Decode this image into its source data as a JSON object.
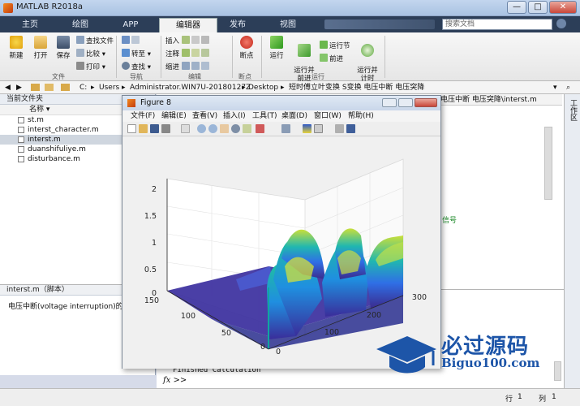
{
  "window": {
    "title": "MATLAB R2018a",
    "min": "—",
    "max": "□",
    "close": "✕"
  },
  "tabs": [
    "主页",
    "绘图",
    "APP",
    "编辑器",
    "发布",
    "视图"
  ],
  "search": {
    "placeholder": "搜索文档"
  },
  "ribbon": {
    "file": {
      "new": "新建",
      "open": "打开",
      "save": "保存",
      "find_files": "查找文件",
      "compare": "比较",
      "print": "打印",
      "group": "文件"
    },
    "nav": {
      "goto": "转至",
      "find": "查找",
      "group": "导航"
    },
    "edit": {
      "insert": "插入",
      "comment": "注释",
      "indent": "缩进",
      "group": "编辑"
    },
    "breakpoints": {
      "bp": "断点",
      "group": "断点"
    },
    "run": {
      "run": "运行",
      "run_advance": "运行并\n前进",
      "run_section": "运行节",
      "advance": "前进",
      "run_time": "运行并\n计时",
      "group": "运行"
    }
  },
  "path": {
    "segments": [
      "C:",
      "Users",
      "Administrator.WIN7U-20180127Z",
      "Desktop",
      "短时傅立叶变换 S变换 电压中断 电压突降"
    ]
  },
  "left_panel": {
    "title": "当前文件夹",
    "column": "名称",
    "files": [
      "st.m",
      "interst_character.m",
      "interst.m",
      "duanshifuliye.m",
      "disturbance.m"
    ],
    "selected_index": 2,
    "detail_title": "interst.m（脚本）",
    "detail_text": "电压中断(voltage interruption)的ST"
  },
  "editor": {
    "tab_path": "电压中断 电压突降\\interst.m",
    "comment_fragment": "信号"
  },
  "right_bar": {
    "label": "工作区"
  },
  "command": {
    "output": "Finished Calculation",
    "prompt": "fx >>"
  },
  "status": {
    "row_label": "行",
    "row": "1",
    "col_label": "列",
    "col": "1"
  },
  "figure": {
    "title": "Figure 8",
    "menu": [
      "文件(F)",
      "编辑(E)",
      "查看(V)",
      "插入(I)",
      "工具(T)",
      "桌面(D)",
      "窗口(W)",
      "帮助(H)"
    ],
    "z_ticks": [
      "2",
      "1.5",
      "1",
      "0.5",
      "0"
    ],
    "y_ticks": [
      "150",
      "100",
      "50",
      "0"
    ],
    "x_ticks": [
      "0",
      "100",
      "200",
      "300"
    ]
  },
  "watermark": {
    "cn": "必过源码",
    "en": "Biguo100.com"
  },
  "colors": {
    "tab_bar": "#2c3e58",
    "surface_low": "#3b2a8c",
    "surface_high": "#c9df3a",
    "watermark": "#1d55a8"
  }
}
